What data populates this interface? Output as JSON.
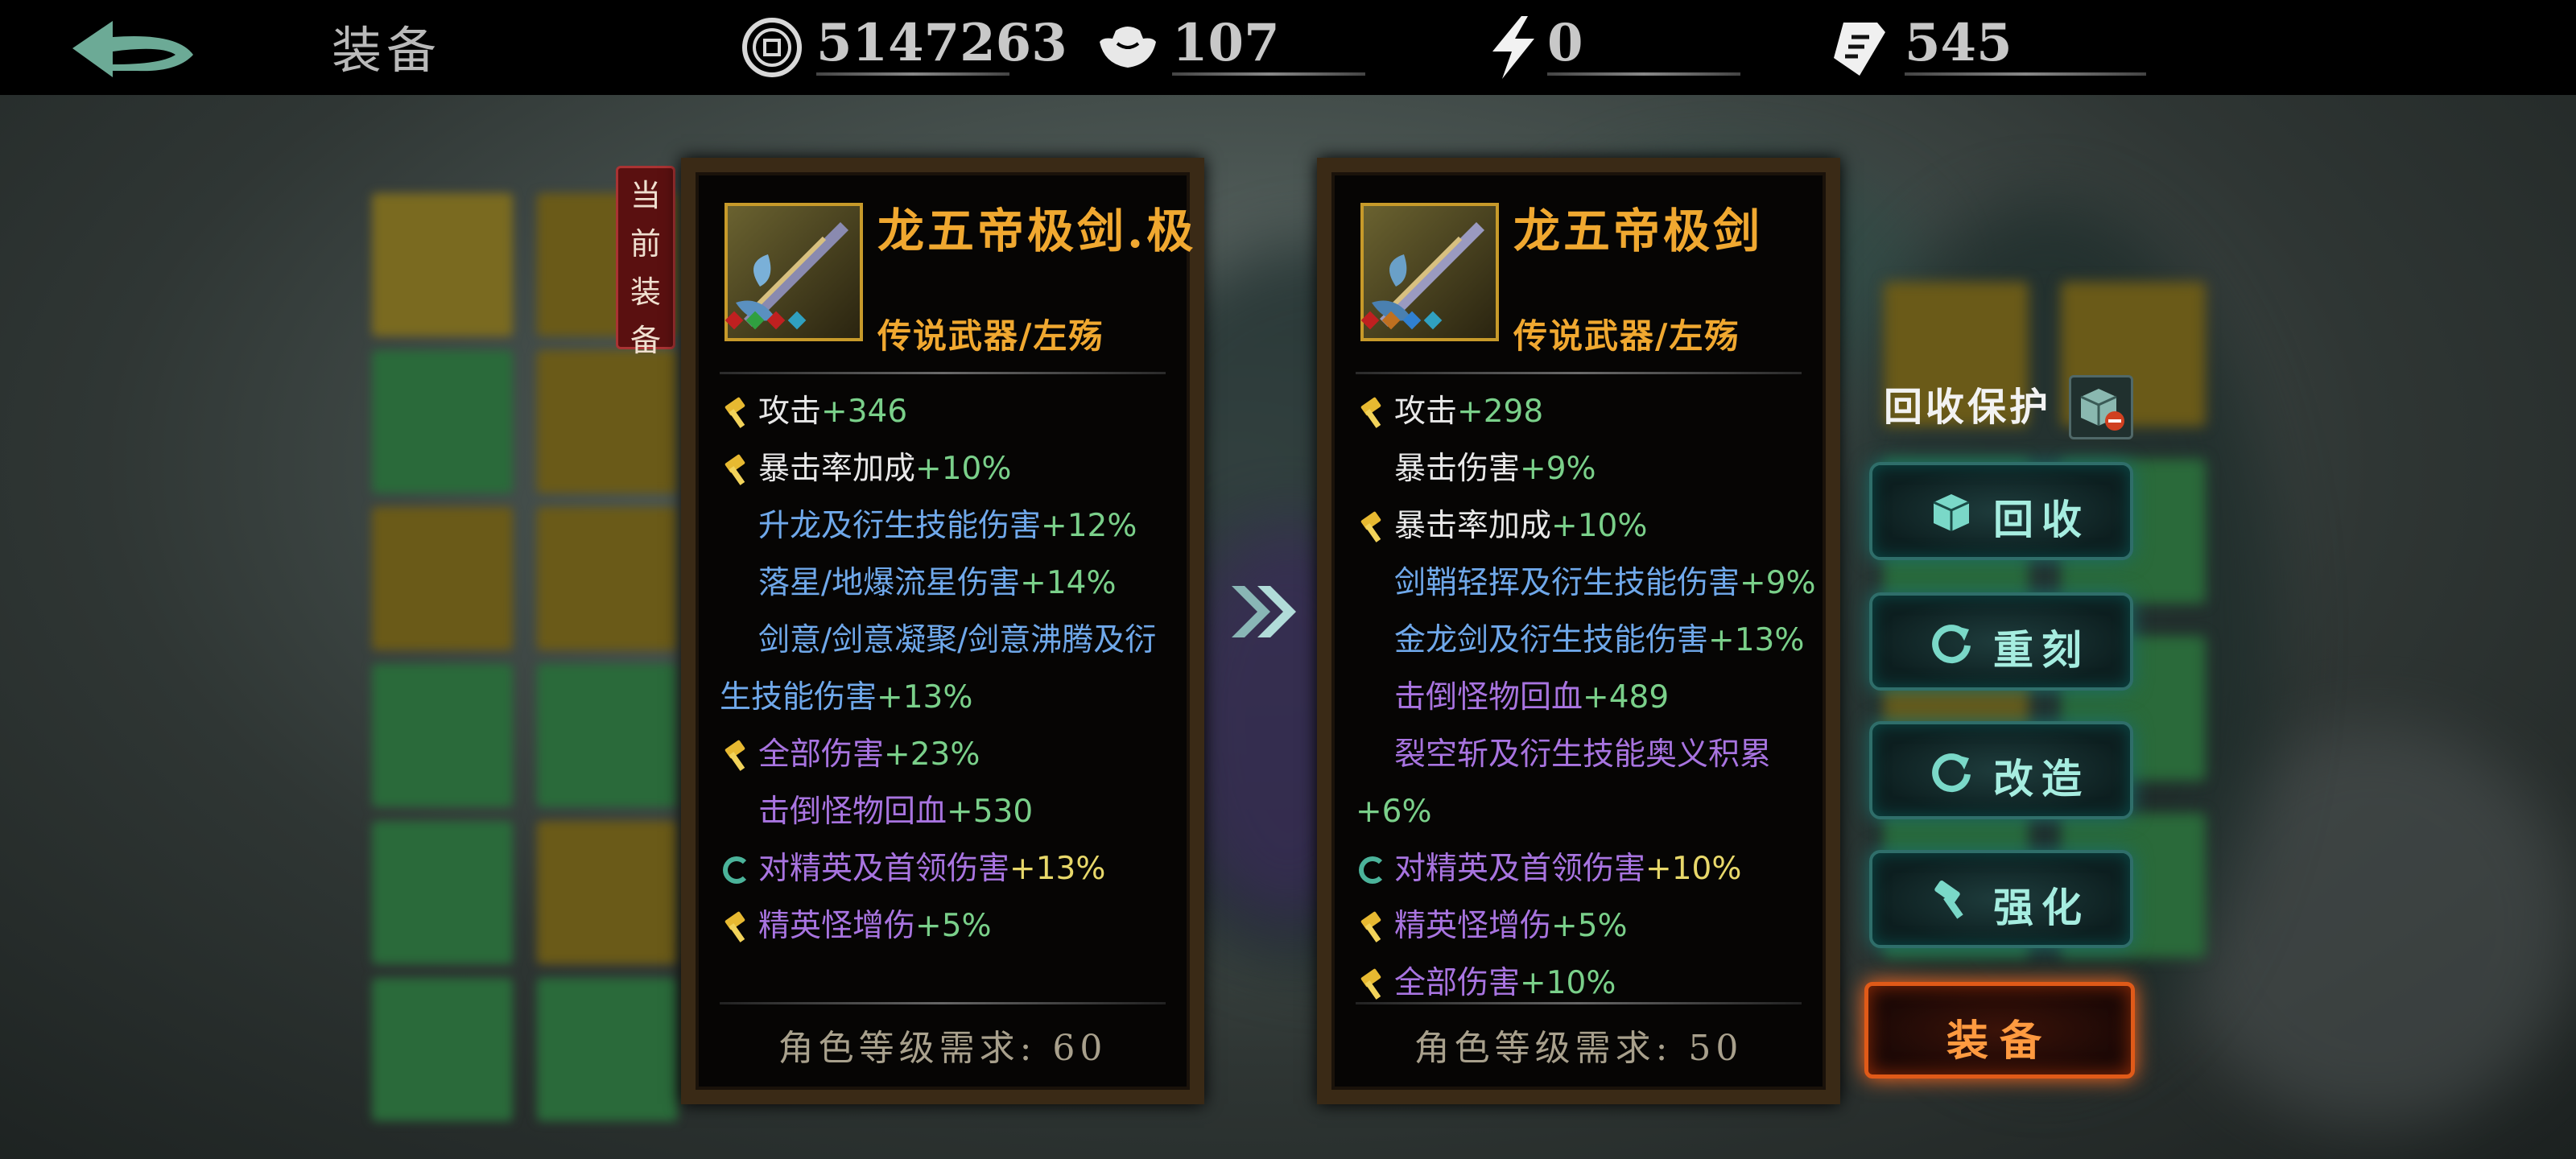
{
  "header": {
    "title": "装备",
    "back_icon": "back-arrow-icon",
    "currencies": [
      {
        "name": "coin",
        "icon": "coin-icon",
        "value": "5147263"
      },
      {
        "name": "silver",
        "icon": "silver-ingot-icon",
        "value": "107"
      },
      {
        "name": "energy",
        "icon": "lightning-icon",
        "value": "0"
      },
      {
        "name": "ticket",
        "icon": "ticket-icon",
        "value": "545"
      }
    ]
  },
  "current_tag": [
    "当",
    "前",
    "装",
    "备"
  ],
  "current_item": {
    "name": "龙五帝极剑.极",
    "type": "传说武器/左殇",
    "gems": [
      "#c02020",
      "#30a040",
      "#c02020",
      "#30a0c0"
    ],
    "stats": [
      {
        "icon": "hammer",
        "label": "攻击",
        "value": "+346",
        "label_color": "#e8e8e8",
        "value_color": "#7ad08a"
      },
      {
        "icon": "hammer",
        "label": "暴击率加成",
        "value": "+10%",
        "label_color": "#e8e8e8",
        "value_color": "#7ad08a"
      },
      {
        "icon": "",
        "label": "升龙及衍生技能伤害",
        "value": "+12%",
        "label_color": "#6fa8ea",
        "value_color": "#7ad08a"
      },
      {
        "icon": "",
        "label": "落星/地爆流星伤害",
        "value": "+14%",
        "label_color": "#6fa8ea",
        "value_color": "#7ad08a"
      },
      {
        "icon": "",
        "label": "剑意/剑意凝聚/剑意沸腾及衍生技能伤害",
        "value": "+13%",
        "label_color": "#6fa8ea",
        "value_color": "#7ad08a",
        "wrap": true
      },
      {
        "icon": "hammer",
        "label": "全部伤害",
        "value": "+23%",
        "label_color": "#a874e0",
        "value_color": "#7ad08a"
      },
      {
        "icon": "",
        "label": "击倒怪物回血",
        "value": "+530",
        "label_color": "#a874e0",
        "value_color": "#7ad08a"
      },
      {
        "icon": "cycle",
        "label": "对精英及首领伤害",
        "value": "+13%",
        "label_color": "#a874e0",
        "value_color": "#e8d86a"
      },
      {
        "icon": "hammer",
        "label": "精英怪增伤",
        "value": "+5%",
        "label_color": "#a874e0",
        "value_color": "#7ad08a"
      }
    ],
    "requirement": "角色等级需求: 60"
  },
  "compare_item": {
    "name": "龙五帝极剑",
    "type": "传说武器/左殇",
    "gems": [
      "#c02020",
      "#c07020",
      "#3080d0",
      "#30a0c0"
    ],
    "stats": [
      {
        "icon": "hammer",
        "label": "攻击",
        "value": "+298",
        "label_color": "#e8e8e8",
        "value_color": "#7ad08a"
      },
      {
        "icon": "",
        "label": "暴击伤害",
        "value": "+9%",
        "label_color": "#e8e8e8",
        "value_color": "#7ad08a"
      },
      {
        "icon": "hammer",
        "label": "暴击率加成",
        "value": "+10%",
        "label_color": "#e8e8e8",
        "value_color": "#7ad08a"
      },
      {
        "icon": "",
        "label": "剑鞘轻挥及衍生技能伤害",
        "value": "+9%",
        "label_color": "#6fa8ea",
        "value_color": "#7ad08a"
      },
      {
        "icon": "",
        "label": "金龙剑及衍生技能伤害",
        "value": "+13%",
        "label_color": "#6fa8ea",
        "value_color": "#7ad08a"
      },
      {
        "icon": "",
        "label": "击倒怪物回血",
        "value": "+489",
        "label_color": "#a874e0",
        "value_color": "#7ad08a"
      },
      {
        "icon": "",
        "label": "裂空斩及衍生技能奥义积累",
        "value": "+6%",
        "label_color": "#a874e0",
        "value_color": "#7ad08a",
        "wrap": true
      },
      {
        "icon": "cycle",
        "label": "对精英及首领伤害",
        "value": "+10%",
        "label_color": "#a874e0",
        "value_color": "#e8d86a"
      },
      {
        "icon": "hammer",
        "label": "精英怪增伤",
        "value": "+5%",
        "label_color": "#a874e0",
        "value_color": "#7ad08a"
      },
      {
        "icon": "hammer",
        "label": "全部伤害",
        "value": "+10%",
        "label_color": "#a874e0",
        "value_color": "#7ad08a"
      }
    ],
    "requirement": "角色等级需求: 50"
  },
  "actions": {
    "protect_label": "回收保护",
    "recycle": "回收",
    "reforge": "重刻",
    "modify": "改造",
    "enhance": "强化",
    "equip": "装备"
  }
}
